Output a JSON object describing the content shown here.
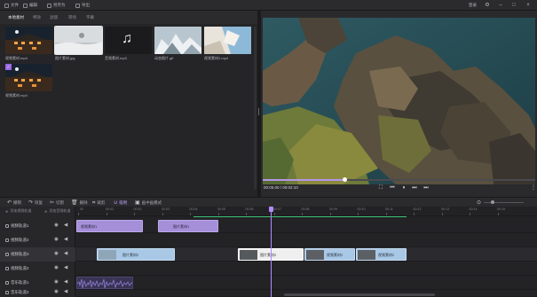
{
  "menu": {
    "items": [
      {
        "label": "文件",
        "icon": "folder-icon"
      },
      {
        "label": "编辑",
        "icon": "edit-icon"
      },
      {
        "label": "另存为",
        "icon": "save-as-icon"
      },
      {
        "label": "导出",
        "icon": "export-icon"
      }
    ],
    "login_label": "登录"
  },
  "library": {
    "tabs": [
      "本地素材",
      "特效",
      "滤镜",
      "转场",
      "字幕"
    ],
    "media": [
      {
        "label": "视频素材.mp4",
        "kind": "night-building-video"
      },
      {
        "label": "图片素材.jpg",
        "kind": "snow-photo",
        "selected": true
      },
      {
        "label": "音频素材.mp3",
        "kind": "music-note"
      },
      {
        "label": "动态图片.gif",
        "kind": "ice-gif"
      },
      {
        "label": "视频素材2.mp4",
        "kind": "ice-video"
      },
      {
        "label": "视频素材.mp4",
        "kind": "night-building-video",
        "badge": true
      }
    ]
  },
  "preview": {
    "timecode": "00:05.00 / 00:02:10",
    "progress": 0.3
  },
  "toolbar": {
    "items": [
      "撤销",
      "恢复",
      "切割",
      "删除",
      "裁剪",
      "吸附",
      "画中画模式"
    ],
    "active_index": 5
  },
  "timeline": {
    "add_video_track_label": "添加视频轨道",
    "add_audio_track_label": "添加音频轨道",
    "ruler": [
      "00",
      "00:02",
      "00:02",
      "00:03",
      "00:04",
      "00:05",
      "00:06",
      "00:07",
      "00:08",
      "00:09",
      "00:10",
      "00:11",
      "00:12",
      "00:13",
      "00:14",
      "00:15"
    ],
    "tracks": [
      {
        "name": "视频轨道1",
        "clips": [
          {
            "label": "视频素材1",
            "style": "purple"
          },
          {
            "label": "图片素材1",
            "style": "purple"
          }
        ]
      },
      {
        "name": "视频轨道2",
        "clips": []
      },
      {
        "name": "视频轨道3",
        "selected": true,
        "clips": [
          {
            "label": "图片素材2",
            "style": "blue"
          },
          {
            "label": "图片素材2",
            "style": "white"
          },
          {
            "label": "视频素材2",
            "style": "blue"
          },
          {
            "label": "视频素材2",
            "style": "blue"
          }
        ]
      },
      {
        "name": "视频轨道4",
        "clips": []
      },
      {
        "name": "音乐轨道1",
        "clips": [
          {
            "label": "",
            "style": "audio"
          }
        ]
      },
      {
        "name": "音乐轨道2",
        "clips": []
      }
    ]
  },
  "colors": {
    "accent": "#b38bff",
    "clip_purple": "#a58fd8",
    "clip_blue": "#a9c8e6",
    "marker_green": "#3fc47a"
  }
}
